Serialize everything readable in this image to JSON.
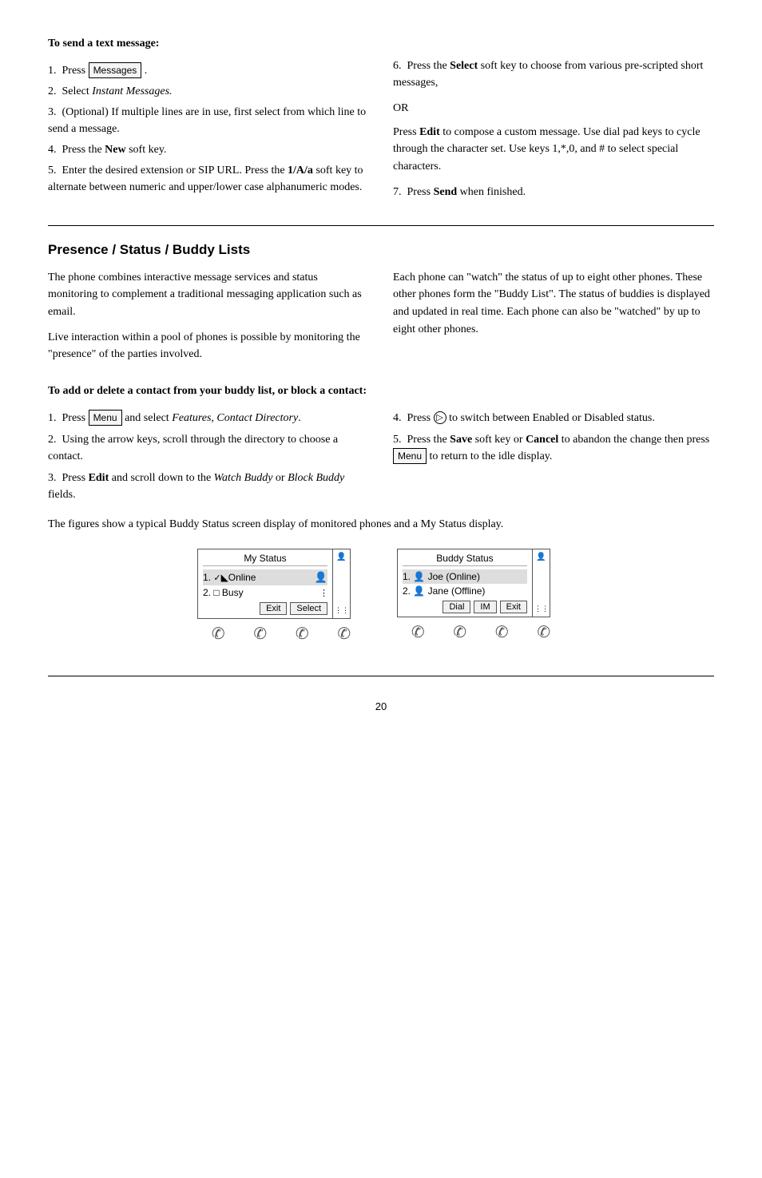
{
  "top_section": {
    "heading": "To send a text message:",
    "left_steps": [
      {
        "num": "1.",
        "text_before": "Press ",
        "key": "Messages",
        "text_after": "."
      },
      {
        "num": "2.",
        "text_before": "Select ",
        "italic": "Instant Messages.",
        "text_after": ""
      },
      {
        "num": "3.",
        "text_before": "(Optional)  If multiple lines are in use, first select from which line to send a message.",
        "text_after": ""
      },
      {
        "num": "4.",
        "text_before": "Press the ",
        "bold": "New",
        "text_after": " soft key."
      },
      {
        "num": "5.",
        "text_before": "Enter the desired extension or SIP URL.  Press the ",
        "bold": "1/A/a",
        "text_after": " soft key to alternate between numeric and upper/lower case alphanumeric modes."
      }
    ],
    "right_steps": [
      {
        "num": "6.",
        "text_before": "Press the ",
        "bold": "Select",
        "text_after": " soft key to choose from various pre-scripted short messages,",
        "or": "OR",
        "press_edit": "Press ",
        "edit_bold": "Edit",
        "edit_after": " to compose a custom message.  Use dial pad keys to cycle through the character set.  Use keys 1,*,0, and # to select special characters."
      },
      {
        "num": "7.",
        "text_before": "Press ",
        "bold": "Send",
        "text_after": " when finished."
      }
    ]
  },
  "presence_section": {
    "heading": "Presence / Status / Buddy Lists",
    "left_para1": "The phone combines interactive message services and status monitoring to complement a traditional messaging application such as email.",
    "left_para2": "Live interaction within a pool of phones is possible by monitoring the \"presence\" of the parties involved.",
    "right_para": "Each phone can \"watch\" the status of up to eight other phones.  These other phones form the \"Buddy List\".  The status of buddies is displayed and updated in real time. Each phone can also be \"watched\" by up to eight other phones.",
    "sub_heading": "To add or delete a contact from your buddy list, or block a contact:",
    "left_steps": [
      {
        "num": "1.",
        "text_before": "Press ",
        "key": "Menu",
        "text_after": " and select ",
        "italic": "Features, Contact Directory",
        "italic_end": "."
      },
      {
        "num": "2.",
        "text_before": "Using the arrow keys, scroll through the directory to choose a contact."
      },
      {
        "num": "3.",
        "text_before": "Press ",
        "bold": "Edit",
        "text_after": " and scroll down to the ",
        "italic": "Watch Buddy",
        "text_mid": " or ",
        "italic2": "Block Buddy",
        "text_end": " fields."
      }
    ],
    "right_steps": [
      {
        "num": "4.",
        "text_before": "Press ",
        "circle": "▶",
        "text_after": " to switch between Enabled or Disabled status."
      },
      {
        "num": "5.",
        "text_before": "Press the ",
        "bold": "Save",
        "text_mid": " soft key or ",
        "bold2": "Cancel",
        "text_after": " to abandon the change then press ",
        "key": "Menu",
        "text_end": " to return to the idle display."
      }
    ],
    "figures_text": "The figures show a typical Buddy Status screen display of monitored phones and a My Status display.",
    "phone1": {
      "title": "My Status",
      "lines": [
        {
          "num": "1.",
          "icon": "✓",
          "icon_style": "check",
          "text": "Online",
          "selected": true
        },
        {
          "num": "2.",
          "icon": "□",
          "text": "Busy",
          "selected": false
        }
      ],
      "softkeys": [
        "Exit",
        "Select"
      ]
    },
    "phone2": {
      "title": "Buddy Status",
      "lines": [
        {
          "num": "1.",
          "icon": "👤",
          "text": "Joe (Online)",
          "selected": true
        },
        {
          "num": "2.",
          "icon": "👤",
          "text": "Jane (Offline)",
          "selected": false
        }
      ],
      "softkeys": [
        "Dial",
        "IM",
        "Exit"
      ]
    }
  },
  "page_number": "20"
}
